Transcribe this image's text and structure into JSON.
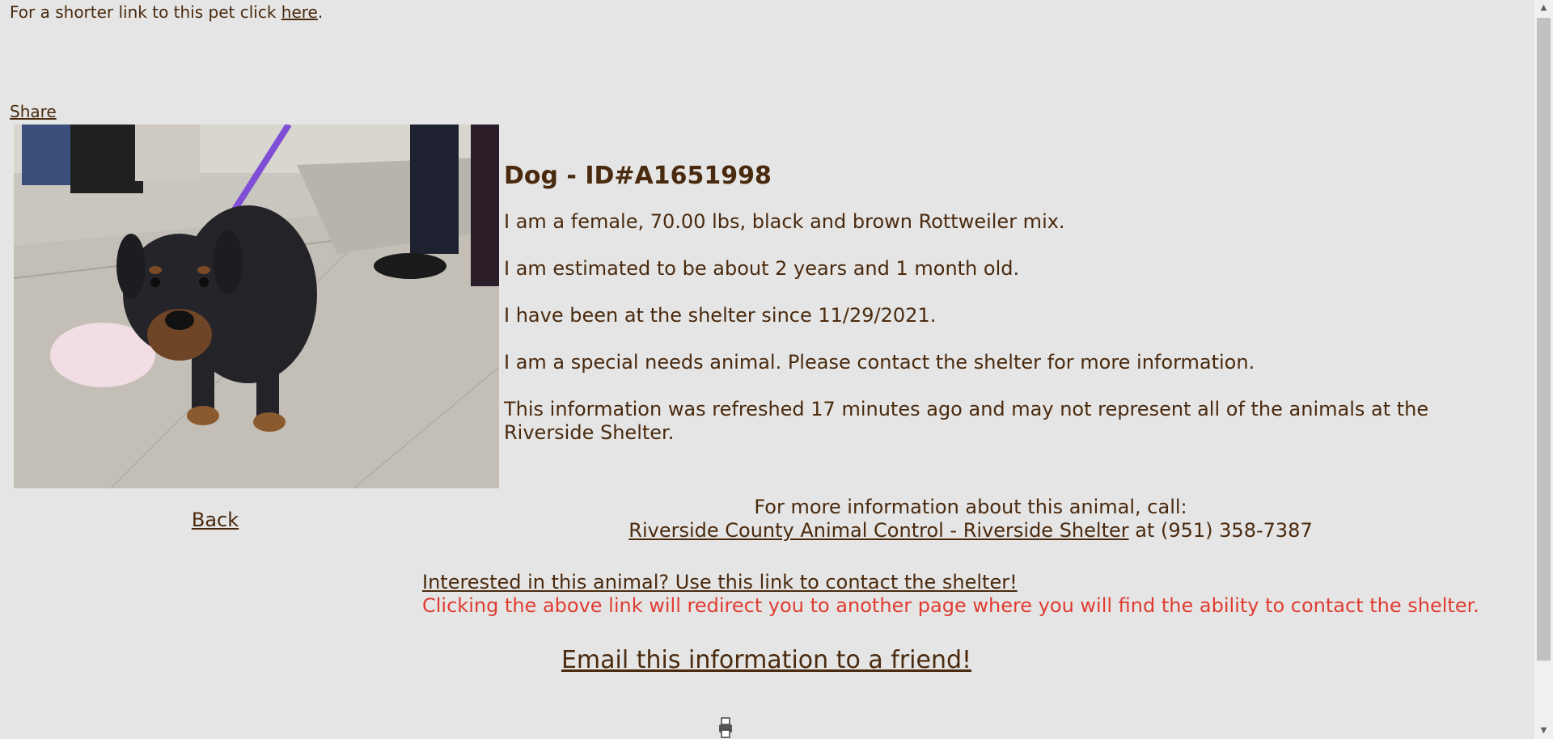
{
  "short_link": {
    "prefix": "For a shorter link to this pet click ",
    "link": "here",
    "suffix": "."
  },
  "share_label": "Share",
  "animal": {
    "title": "Dog - ID#A1651998",
    "lines": [
      "I am a female, 70.00 lbs, black and brown Rottweiler mix.",
      "I am estimated to be about 2 years and 1 month old.",
      "I have been at the shelter since 11/29/2021.",
      "I am a special needs animal. Please contact the shelter for more information.",
      "This information was refreshed 17 minutes ago and may not represent all of the animals at the Riverside Shelter."
    ]
  },
  "back_label": "Back",
  "contact": {
    "heading": "For more information about this animal, call:",
    "shelter_link": "Riverside County Animal Control - Riverside Shelter",
    "phone_text": " at (951) 358-7387"
  },
  "interested": {
    "link": "Interested in this animal? Use this link to contact the shelter!",
    "note": "Clicking the above link will redirect you to another page where you will find the ability to contact the shelter."
  },
  "email_label": "Email this information to a friend!",
  "icons": {
    "bottom": "printer-icon",
    "scroll_up": "arrow-up-icon",
    "scroll_down": "arrow-down-icon"
  },
  "colors": {
    "background": "#e5e5e5",
    "text": "#4a2a0e",
    "note": "#e03c31"
  }
}
